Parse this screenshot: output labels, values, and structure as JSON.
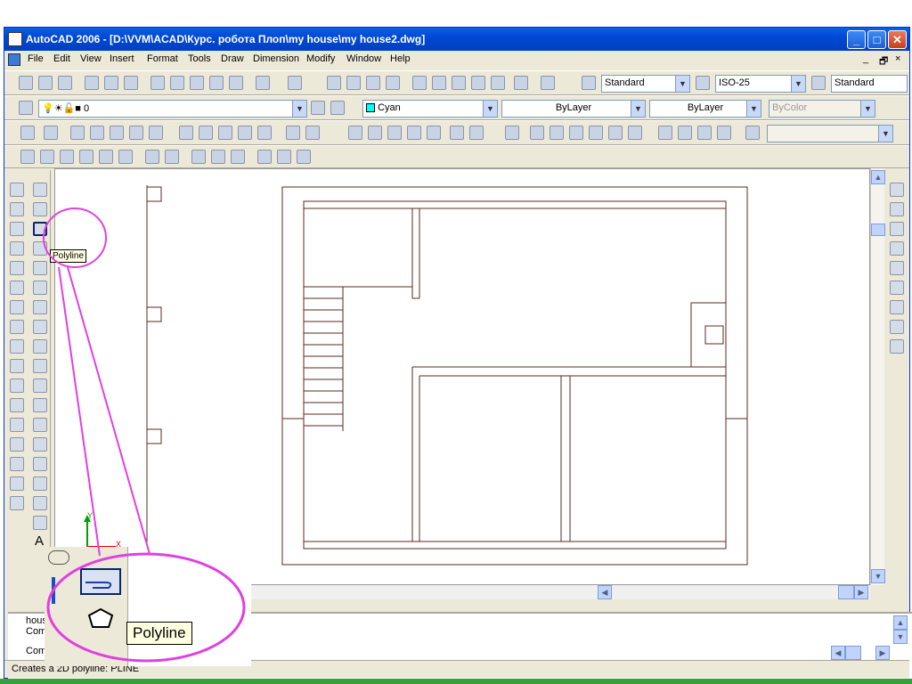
{
  "window": {
    "title": "AutoCAD 2006 - [D:\\VVM\\ACAD\\Курс. робота Плоп\\my house\\my house2.dwg]",
    "minimize": "_",
    "maximize": "□",
    "close": "✕"
  },
  "menu": {
    "items": [
      "File",
      "Edit",
      "View",
      "Insert",
      "Format",
      "Tools",
      "Draw",
      "Dimension",
      "Modify",
      "Window",
      "Help"
    ],
    "doc_controls": [
      "_",
      "🗗",
      "×"
    ]
  },
  "styles_toolbar": {
    "text_style": "Standard",
    "dim_style": "ISO-25",
    "table_style": "Standard"
  },
  "layers_toolbar": {
    "layer": "0"
  },
  "properties_toolbar": {
    "color": "Cyan",
    "linetype": "ByLayer",
    "lineweight": "ByLayer",
    "plotstyle": "ByColor"
  },
  "tooltip": {
    "text": "Polyline"
  },
  "inset": {
    "tooltip": "Polyline"
  },
  "ucs": {
    "y_label": "Y",
    "x_label": "X"
  },
  "command": {
    "line1": "hous",
    "line2": "Com",
    "line3": "Com"
  },
  "status": {
    "text": "Creates a 2D polyline:  PLINE"
  },
  "colors": {
    "titlebar": "#0049d4",
    "annotation": "#e040e0",
    "drawing_lines": "#5a2a20",
    "cyan_swatch": "#00ffff"
  }
}
